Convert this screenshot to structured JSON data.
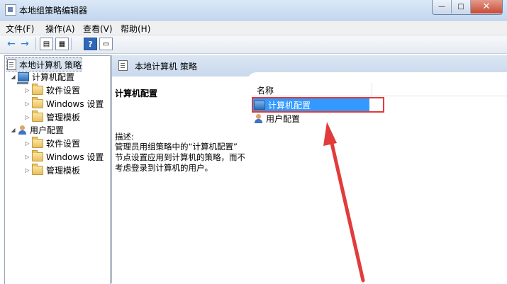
{
  "window": {
    "title": "本地组策略编辑器",
    "buttons": {
      "minimize": "—",
      "maximize": "□",
      "close": "✕"
    }
  },
  "menu": [
    "文件(F)",
    "操作(A)",
    "查看(V)",
    "帮助(H)"
  ],
  "toolbar": {
    "back_icon": "←",
    "forward_icon": "→",
    "show_hide_icon": "▤",
    "properties_icon": "▦",
    "help_icon": "?",
    "panel_icon": "▭"
  },
  "tree": {
    "root": "本地计算机 策略",
    "computer_config": "计算机配置",
    "user_config": "用户配置",
    "children": [
      "软件设置",
      "Windows 设置",
      "管理模板"
    ]
  },
  "details": {
    "header": "本地计算机 策略",
    "selected_title": "计算机配置",
    "description_label": "描述:",
    "description_lines": [
      "管理员用组策略中的“计算机配置”",
      "节点设置应用到计算机的策略，而不",
      "考虑登录到计算机的用户。"
    ],
    "column_name": "名称",
    "items": [
      "计算机配置",
      "用户配置"
    ]
  },
  "colors": {
    "annotation": "#e23b3b",
    "selection": "#3399ff"
  }
}
